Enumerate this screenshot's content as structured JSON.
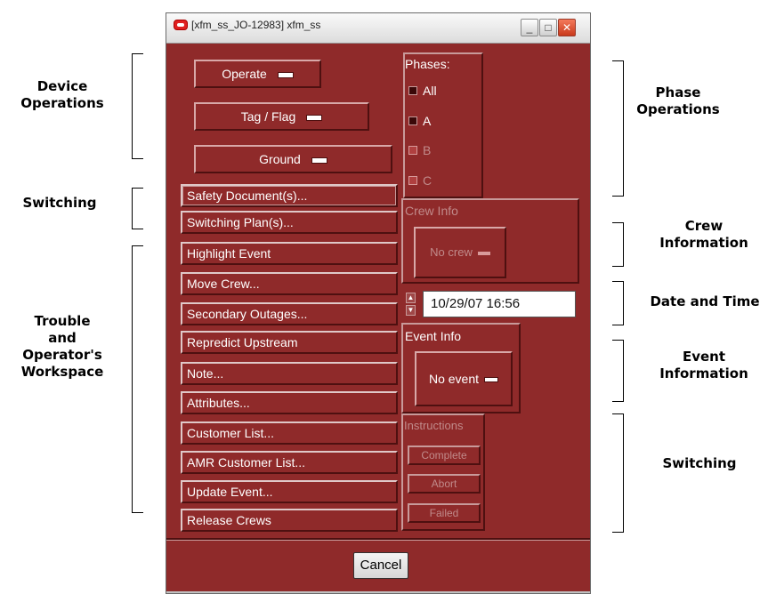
{
  "annotations": {
    "device_operations": [
      "Device",
      "Operations"
    ],
    "switching_top": "Switching",
    "trouble": [
      "Trouble",
      "and",
      "Operator's",
      "Workspace"
    ],
    "phase_operations": [
      "Phase",
      "Operations"
    ],
    "crew_information": [
      "Crew",
      "Information"
    ],
    "date_and_time": "Date and Time",
    "event_information": [
      "Event",
      "Information"
    ],
    "switching_bottom": "Switching"
  },
  "window": {
    "title": "[xfm_ss_JO-12983] xfm_ss",
    "controls": {
      "minimize": "_",
      "maximize": "□",
      "close": "✕"
    },
    "option_menus": [
      "Operate",
      "Tag / Flag",
      "Ground"
    ],
    "phases": {
      "label": "Phases:",
      "items": [
        {
          "label": "All",
          "enabled": true
        },
        {
          "label": "A",
          "enabled": true
        },
        {
          "label": "B",
          "enabled": false
        },
        {
          "label": "C",
          "enabled": false
        }
      ]
    },
    "action_buttons": [
      "Safety Document(s)...",
      "Switching Plan(s)...",
      "Highlight Event",
      "Move Crew...",
      "Secondary Outages...",
      "Repredict Upstream",
      "Note...",
      "Attributes...",
      "Customer List...",
      "AMR Customer List...",
      "Update Event...",
      "Release Crews"
    ],
    "crew_info": {
      "label": "Crew Info",
      "button": "No crew"
    },
    "date_time": {
      "value": "10/29/07 16:56"
    },
    "event_info": {
      "label": "Event Info",
      "button": "No event"
    },
    "instructions": {
      "label": "Instructions",
      "buttons": [
        "Complete",
        "Abort",
        "Failed"
      ]
    },
    "cancel": "Cancel"
  },
  "colors": {
    "window_background": "#8f2a2a",
    "button_text": "#ffffff",
    "disabled_text": "#c08a8a"
  }
}
